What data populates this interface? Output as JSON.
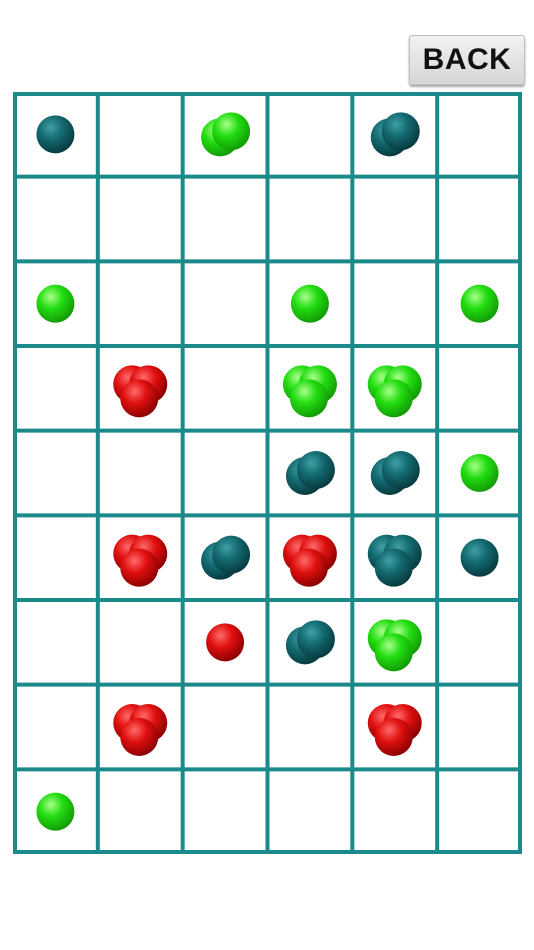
{
  "back_button": {
    "label": "BACK"
  },
  "colors": {
    "grid": "#1a8a8a",
    "red": "#e01010",
    "green": "#22dd11",
    "teal": "#136a70",
    "cell_bg": "#ffffff"
  },
  "board": {
    "columns": 6,
    "rows": 9,
    "cells": [
      {
        "row": 0,
        "col": 0,
        "color": "teal",
        "count": 1
      },
      {
        "row": 0,
        "col": 2,
        "color": "green",
        "count": 2
      },
      {
        "row": 0,
        "col": 4,
        "color": "teal",
        "count": 2
      },
      {
        "row": 2,
        "col": 0,
        "color": "green",
        "count": 1
      },
      {
        "row": 2,
        "col": 3,
        "color": "green",
        "count": 1
      },
      {
        "row": 2,
        "col": 5,
        "color": "green",
        "count": 1
      },
      {
        "row": 3,
        "col": 1,
        "color": "red",
        "count": 3
      },
      {
        "row": 3,
        "col": 3,
        "color": "green",
        "count": 3
      },
      {
        "row": 3,
        "col": 4,
        "color": "green",
        "count": 3
      },
      {
        "row": 4,
        "col": 3,
        "color": "teal",
        "count": 2
      },
      {
        "row": 4,
        "col": 4,
        "color": "teal",
        "count": 2
      },
      {
        "row": 4,
        "col": 5,
        "color": "green",
        "count": 1
      },
      {
        "row": 5,
        "col": 1,
        "color": "red",
        "count": 3
      },
      {
        "row": 5,
        "col": 2,
        "color": "teal",
        "count": 2
      },
      {
        "row": 5,
        "col": 3,
        "color": "red",
        "count": 3
      },
      {
        "row": 5,
        "col": 4,
        "color": "teal",
        "count": 3
      },
      {
        "row": 5,
        "col": 5,
        "color": "teal",
        "count": 1
      },
      {
        "row": 6,
        "col": 2,
        "color": "red",
        "count": 1
      },
      {
        "row": 6,
        "col": 3,
        "color": "teal",
        "count": 2
      },
      {
        "row": 6,
        "col": 4,
        "color": "green",
        "count": 3
      },
      {
        "row": 7,
        "col": 1,
        "color": "red",
        "count": 3
      },
      {
        "row": 7,
        "col": 4,
        "color": "red",
        "count": 3
      },
      {
        "row": 8,
        "col": 0,
        "color": "green",
        "count": 1
      }
    ]
  }
}
